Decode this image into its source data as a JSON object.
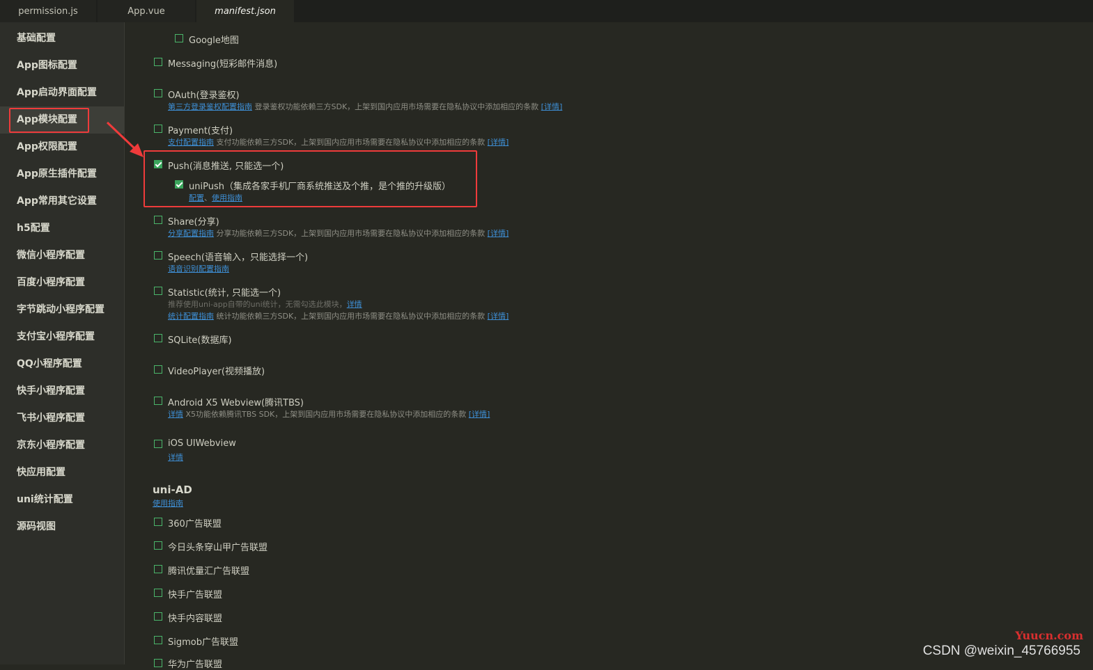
{
  "tabs": [
    {
      "label": "permission.js"
    },
    {
      "label": "App.vue"
    },
    {
      "label": "manifest.json"
    }
  ],
  "sidebar": {
    "items": [
      {
        "label": "基础配置"
      },
      {
        "label": "App图标配置"
      },
      {
        "label": "App启动界面配置"
      },
      {
        "label": "App模块配置"
      },
      {
        "label": "App权限配置"
      },
      {
        "label": "App原生插件配置"
      },
      {
        "label": "App常用其它设置"
      },
      {
        "label": "h5配置"
      },
      {
        "label": "微信小程序配置"
      },
      {
        "label": "百度小程序配置"
      },
      {
        "label": "字节跳动小程序配置"
      },
      {
        "label": "支付宝小程序配置"
      },
      {
        "label": "QQ小程序配置"
      },
      {
        "label": "快手小程序配置"
      },
      {
        "label": "飞书小程序配置"
      },
      {
        "label": "京东小程序配置"
      },
      {
        "label": "快应用配置"
      },
      {
        "label": "uni统计配置"
      },
      {
        "label": "源码视图"
      }
    ]
  },
  "modules": {
    "google_map": "Google地图",
    "messaging": "Messaging(短彩邮件消息)",
    "oauth": "OAuth(登录鉴权)",
    "oauth_link": "第三方登录鉴权配置指南",
    "oauth_note": "登录鉴权功能依赖三方SDK，上架到国内应用市场需要在隐私协议中添加相应的条款",
    "detail_bracket": "[详情]",
    "payment": "Payment(支付)",
    "payment_link": "支付配置指南",
    "payment_note": "支付功能依赖三方SDK，上架到国内应用市场需要在隐私协议中添加相应的条款",
    "push": "Push(消息推送, 只能选一个)",
    "unipush": "uniPush（集成各家手机厂商系统推送及个推，是个推的升级版）",
    "unipush_config": "配置",
    "unipush_sep": "、",
    "unipush_guide": "使用指南",
    "share": "Share(分享)",
    "share_link": "分享配置指南",
    "share_note": "分享功能依赖三方SDK，上架到国内应用市场需要在隐私协议中添加相应的条款",
    "speech": "Speech(语音输入，只能选择一个)",
    "speech_link": "语音识别配置指南",
    "statistic": "Statistic(统计, 只能选一个)",
    "statistic_tip": "推荐使用uni-app自带的uni统计，无需勾选此模块，",
    "detail": "详情",
    "statistic_link": "统计配置指南",
    "statistic_note": "统计功能依赖三方SDK，上架到国内应用市场需要在隐私协议中添加相应的条款",
    "sqlite": "SQLite(数据库)",
    "videoplayer": "VideoPlayer(视频播放)",
    "x5": "Android X5 Webview(腾讯TBS)",
    "x5_note": "X5功能依赖腾讯TBS SDK，上架到国内应用市场需要在隐私协议中添加相应的条款",
    "ios_uiwebview": "iOS UIWebview"
  },
  "uniad": {
    "title": "uni-AD",
    "guide": "使用指南",
    "items": [
      {
        "label": "360广告联盟"
      },
      {
        "label": "今日头条穿山甲广告联盟"
      },
      {
        "label": "腾讯优量汇广告联盟"
      },
      {
        "label": "快手广告联盟"
      },
      {
        "label": "快手内容联盟"
      },
      {
        "label": "Sigmob广告联盟"
      },
      {
        "label": "华为广告联盟"
      }
    ]
  },
  "watermark": "Yuucn.com",
  "csdn": "CSDN @weixin_45766955",
  "colors": {
    "background": "#272822",
    "highlight": "#ef3b3b",
    "checkbox": "#3ba55c",
    "link": "#3e8fd6"
  }
}
